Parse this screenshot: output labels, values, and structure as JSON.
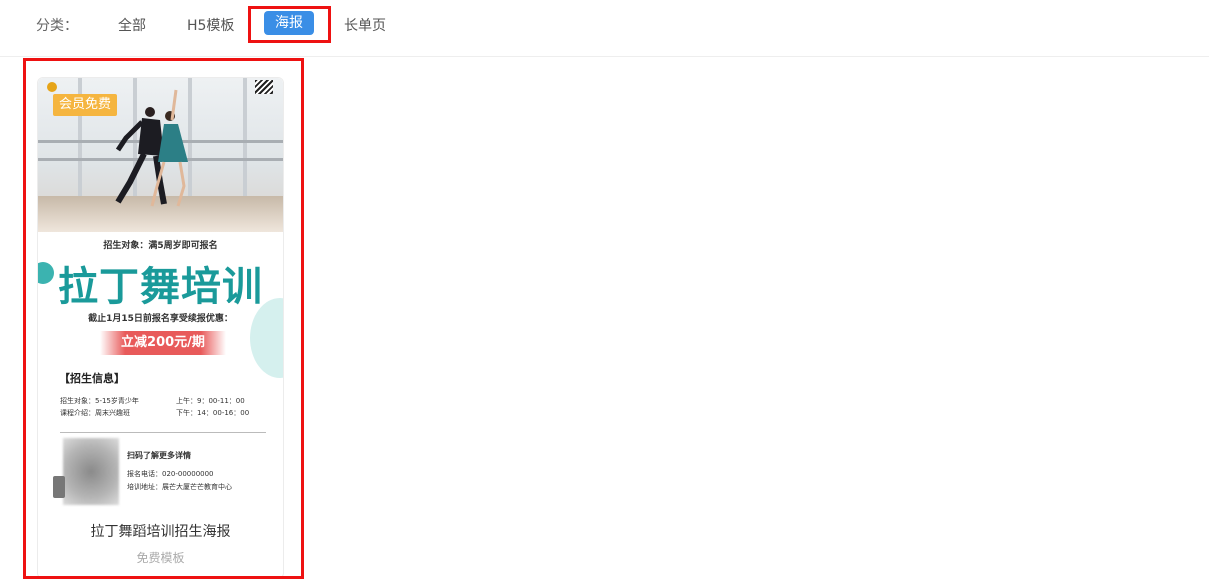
{
  "filter": {
    "label": "分类：",
    "categories": [
      "全部",
      "H5模板",
      "海报",
      "长单页"
    ],
    "active": "海报"
  },
  "card": {
    "badge": "会员免费",
    "title": "拉丁舞蹈培训招生海报",
    "price": "免费模板",
    "poster": {
      "subtitle": "招生对象：满5周岁即可报名",
      "headline": "拉丁舞培训",
      "deadline": "截止1月15日前报名享受续报优惠：",
      "discount": "立减200元/期",
      "info_heading": "【招生信息】",
      "info_left": [
        "招生对象：5-15岁青少年",
        "课程介绍：周末兴趣班"
      ],
      "info_right": [
        "上午：9：00-11：00",
        "下午：14：00-16：00"
      ],
      "scan_text": "扫码了解更多详情",
      "phone": "报名电话：020-00000000",
      "address": "培训地址：展芒大厦芒芒教育中心"
    }
  },
  "colors": {
    "accent": "#3a8ee6",
    "badge": "#f5b53f",
    "headline": "#1a9a9a",
    "discount": "#e85a5a",
    "highlight": "#ee1111"
  }
}
